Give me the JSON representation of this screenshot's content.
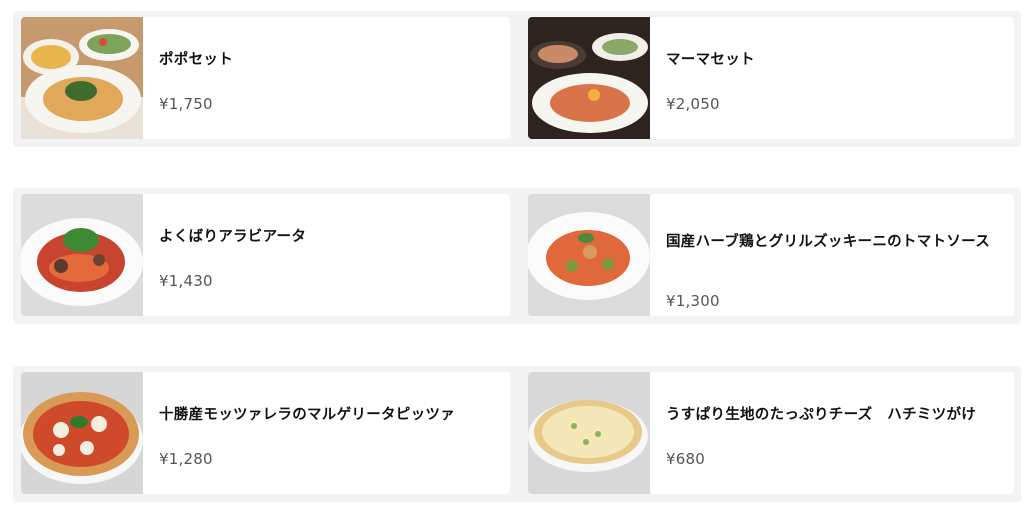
{
  "menu": {
    "items": [
      {
        "name": "ポポセット",
        "price": "¥1,750",
        "image": "set-meal-photo"
      },
      {
        "name": "マーマセット",
        "price": "¥2,050",
        "image": "set-meal-photo"
      },
      {
        "name": "よくばりアラビアータ",
        "price": "¥1,430",
        "image": "pasta-photo"
      },
      {
        "name": "国産ハーブ鶏とグリルズッキーニのトマトソース",
        "price": "¥1,300",
        "image": "pasta-photo"
      },
      {
        "name": "十勝産モッツァレラのマルゲリータピッツァ",
        "price": "¥1,280",
        "image": "pizza-photo"
      },
      {
        "name": "うすぱり生地のたっぷりチーズ　ハチミツがけ",
        "price": "¥680",
        "image": "pizza-photo"
      }
    ]
  },
  "colors": {
    "row_background": "#f3f3f3",
    "card_background": "#ffffff",
    "name_text": "#111111",
    "price_text": "#555555"
  }
}
